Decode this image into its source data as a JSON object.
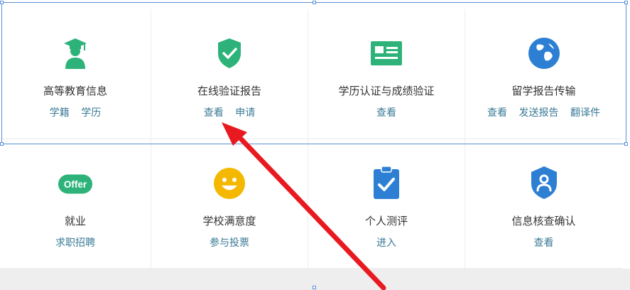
{
  "services": [
    {
      "title": "高等教育信息",
      "links": [
        "学籍",
        "学历"
      ],
      "icon": "graduate-icon"
    },
    {
      "title": "在线验证报告",
      "links": [
        "查看",
        "申请"
      ],
      "icon": "shield-check-icon"
    },
    {
      "title": "学历认证与成绩验证",
      "links": [
        "查看"
      ],
      "icon": "id-card-icon"
    },
    {
      "title": "留学报告传输",
      "links": [
        "查看",
        "发送报告",
        "翻译件"
      ],
      "icon": "globe-icon"
    },
    {
      "title": "就业",
      "links": [
        "求职招聘"
      ],
      "icon": "offer-badge-icon",
      "badge": "Offer"
    },
    {
      "title": "学校满意度",
      "links": [
        "参与投票"
      ],
      "icon": "smiley-icon"
    },
    {
      "title": "个人测评",
      "links": [
        "进入"
      ],
      "icon": "clipboard-check-icon"
    },
    {
      "title": "信息核查确认",
      "links": [
        "查看"
      ],
      "icon": "user-shield-icon"
    }
  ],
  "colors": {
    "green": "#2db37a",
    "blue": "#2d7fd3",
    "yellow": "#f5b800",
    "link": "#3a7a96",
    "arrow": "#e8191f"
  }
}
